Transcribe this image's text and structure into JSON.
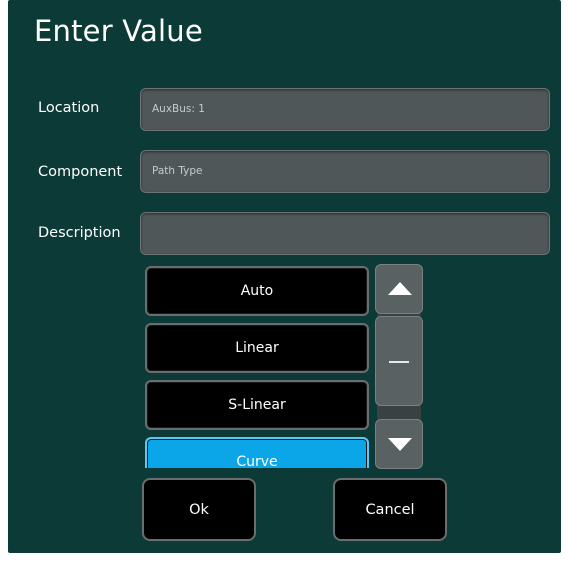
{
  "dialog": {
    "title": "Enter Value"
  },
  "fields": {
    "location": {
      "label": "Location",
      "value": "AuxBus: 1"
    },
    "component": {
      "label": "Component",
      "value": "Path Type"
    },
    "description": {
      "label": "Description",
      "value": ""
    }
  },
  "options": {
    "items": [
      {
        "label": "Auto"
      },
      {
        "label": "Linear"
      },
      {
        "label": "S-Linear"
      },
      {
        "label": "Curve"
      }
    ],
    "selected": "Curve"
  },
  "scrollbar": {
    "up_icon": "triangle-up-icon",
    "thumb_icon": "grip-line-icon",
    "down_icon": "triangle-down-icon"
  },
  "actions": {
    "ok_label": "Ok",
    "cancel_label": "Cancel"
  },
  "colors": {
    "panel_bg": "#0c3a36",
    "field_bg": "#505759",
    "button_bg": "#000000",
    "selected_bg": "#0aa6e8"
  }
}
